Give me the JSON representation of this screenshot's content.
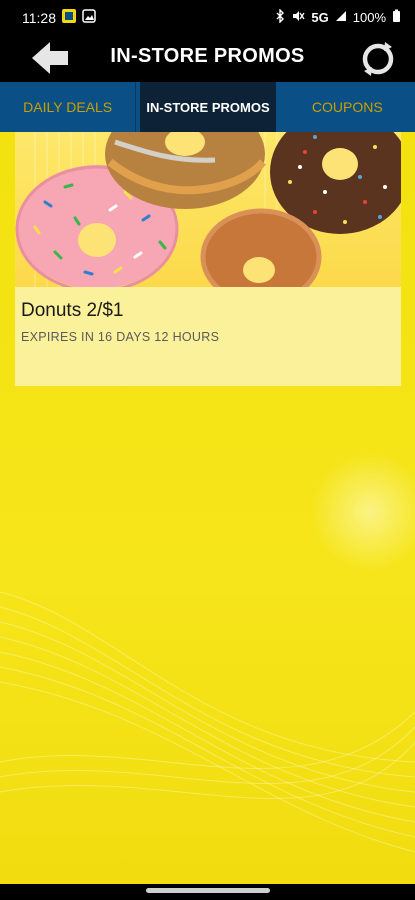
{
  "status_bar": {
    "time": "11:28",
    "battery": "100%",
    "network": "5G",
    "icons": [
      "app-notification-icon",
      "gallery-icon",
      "bluetooth-icon",
      "mute-icon",
      "signal-icon",
      "battery-icon"
    ]
  },
  "header": {
    "title": "IN-STORE PROMOS",
    "back_icon": "back-arrow-icon",
    "refresh_icon": "refresh-icon"
  },
  "tabs": [
    {
      "label": "DAILY DEALS",
      "active": false
    },
    {
      "label": "IN-STORE PROMOS",
      "active": true
    },
    {
      "label": "COUPONS",
      "active": false
    }
  ],
  "promos": [
    {
      "title": "Donuts 2/$1",
      "expiry": "EXPIRES IN 16 DAYS 12 HOURS",
      "image": "donuts-image"
    }
  ],
  "colors": {
    "tab_bar": "#0a4f86",
    "tab_active": "#0d2236",
    "tab_inactive_text": "#c9a000",
    "background": "#f3e20f",
    "card": "#fbf19a"
  }
}
